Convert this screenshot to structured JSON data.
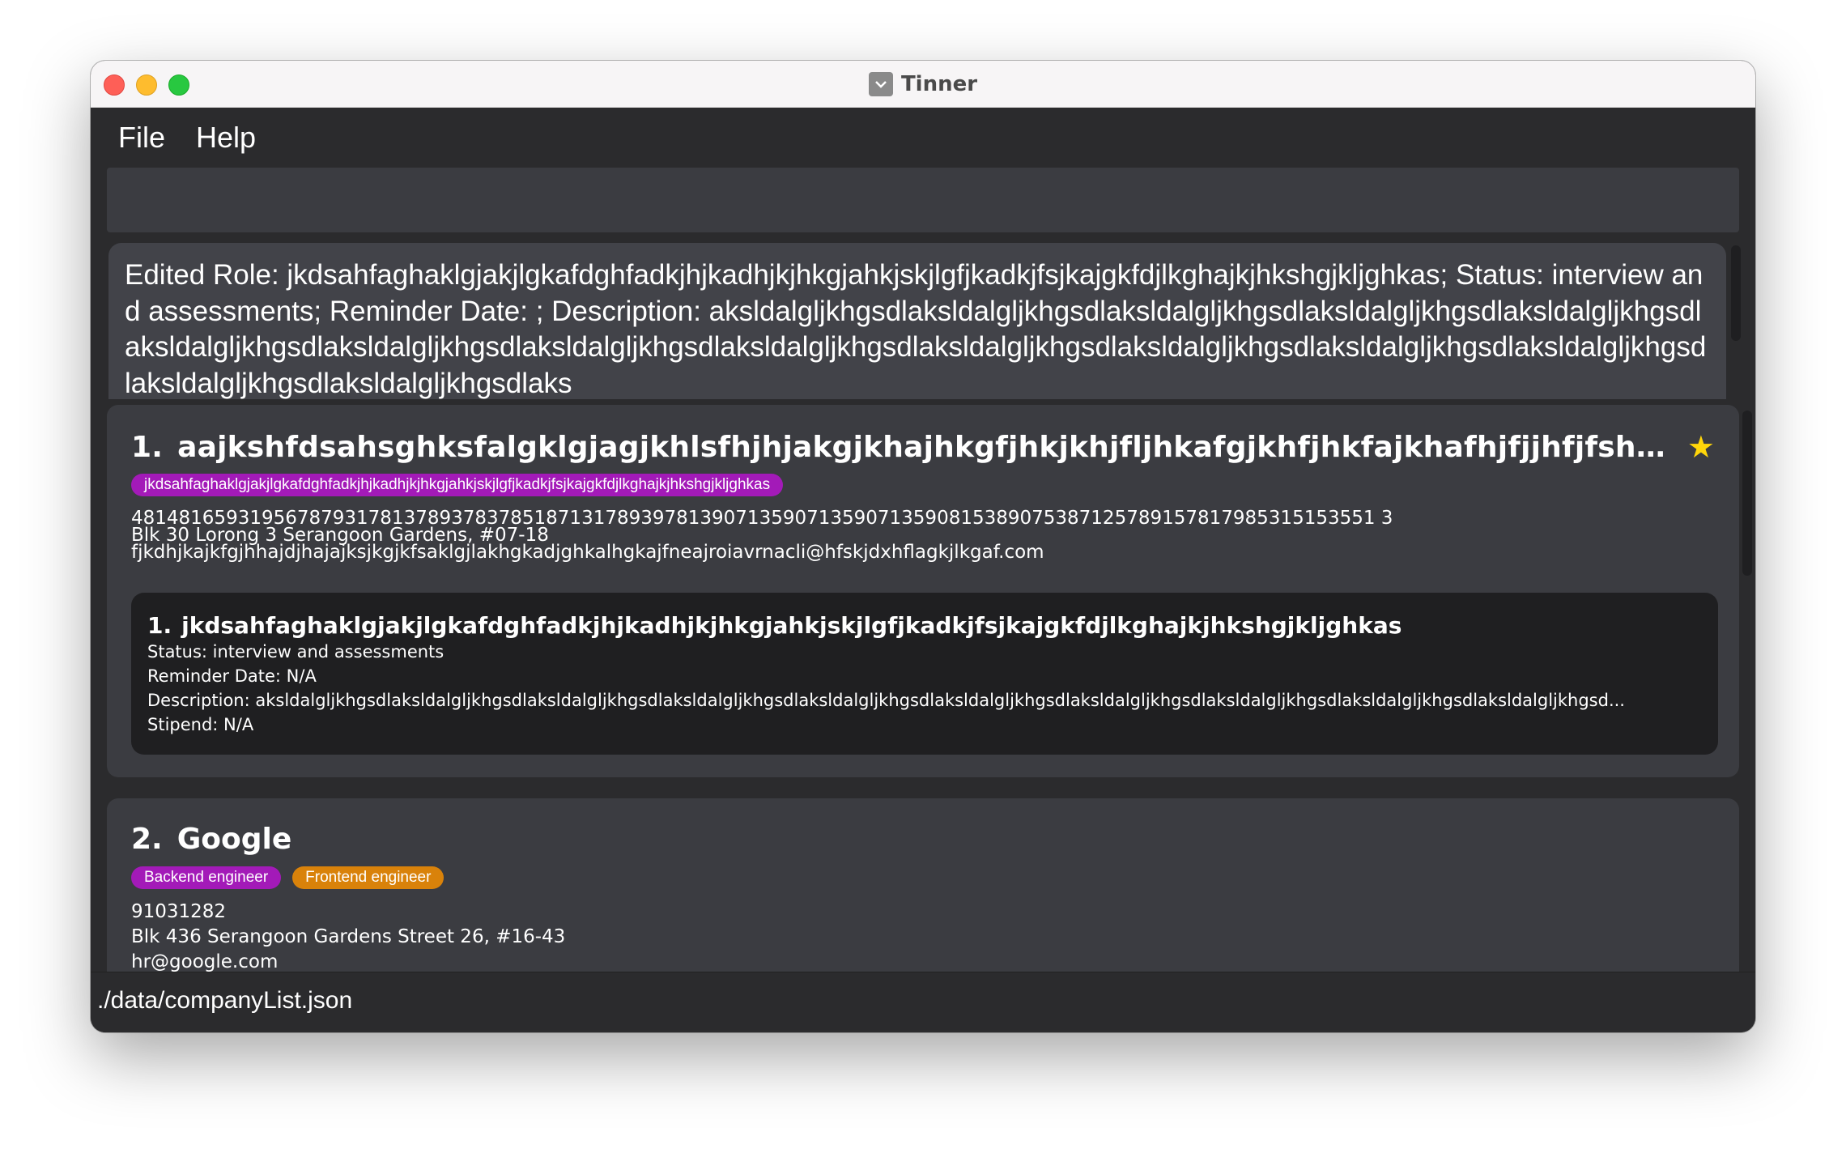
{
  "window": {
    "title": "Tinner",
    "app_icon": "chevron-down-box-icon"
  },
  "menu": {
    "file": "File",
    "help": "Help"
  },
  "command_box": {
    "value": ""
  },
  "result": {
    "text": "Edited Role: jkdsahfaghaklgjakjlgkafdghfadkjhjkadhjkjhkgjahkjskjlgfjkadkjfsjkajgkfdjlkghajkjhkshgjkljghkas; Status: interview and assessments; Reminder Date: ; Description: aksldalgljkhgsdlaksldalgljkhgsdlaksldalgljkhgsdlaksldalgljkhgsdlaksldalgljkhgsdlaksldalgljkhgsdlaksldalgljkhgsdlaksldalgljkhgsdlaksldalgljkhgsdlaksldalgljkhgsdlaksldalgljkhgsdlaksldalgljkhgsdlaksldalgljkhgsdlaksldalgljkhgsdlaksldalgljkhgsdlaks"
  },
  "companies": [
    {
      "index": "1.",
      "name": "aajkshfdsahsghksfalgklgjagjkhlsfhjhjakgjkhajhkgfjhkjkhjfljhkafgjkhfjhkfajkhafhjfjjhfjfshgjlgafsjafgj...",
      "favourite": true,
      "star": "★",
      "tags": [
        "jkdsahfaghaklgjakjlgkafdghfadkjhjkadhjkjhkgjahkjskjlgfjkadkjfsjkajgkfdjlkghajkjhkshgjkljghkas"
      ],
      "phone": "481481659319567879317813789378378518713178939781390713590713590713590815389075387125789157817985315153551 3",
      "address": "Blk 30 Lorong 3 Serangoon Gardens, #07-18",
      "email": "fjkdhjkajkfgjhhajdjhajajksjkgjkfsaklgjlakhgkadjghkalhgkajfneajroiavrnacli@hfskjdxhflagkjlkgaf.com",
      "role": {
        "index": "1.",
        "title": "jkdsahfaghaklgjakjlgkafdghfadkjhjkadhjkjhkgjahkjskjlgfjkadkjfsjkajgkfdjlkghajkjhkshgjkljghkas",
        "status": "Status: interview and assessments",
        "reminder": "Reminder Date: N/A",
        "description": "Description: aksldalgljkhgsdlaksldalgljkhgsdlaksldalgljkhgsdlaksldalgljkhgsdlaksldalgljkhgsdlaksldalgljkhgsdlaksldalgljkhgsdlaksldalgljkhgsdlaksldalgljkhgsdlaksldalgljkhgsd...",
        "stipend": "Stipend: N/A"
      }
    },
    {
      "index": "2.",
      "name": "Google",
      "tags": [
        "Backend engineer",
        "Frontend engineer"
      ],
      "tag_colors": [
        "#a31ab8",
        "#d9820a"
      ],
      "phone": "91031282",
      "address": "Blk 436 Serangoon Gardens Street 26, #16-43",
      "email": "hr@google.com"
    }
  ],
  "status_bar": {
    "path": "./data/companyList.json"
  },
  "colors": {
    "favourite_star": "#ffd60a",
    "card_bg": "#3b3c41",
    "window_bg": "#2b2b2d"
  }
}
